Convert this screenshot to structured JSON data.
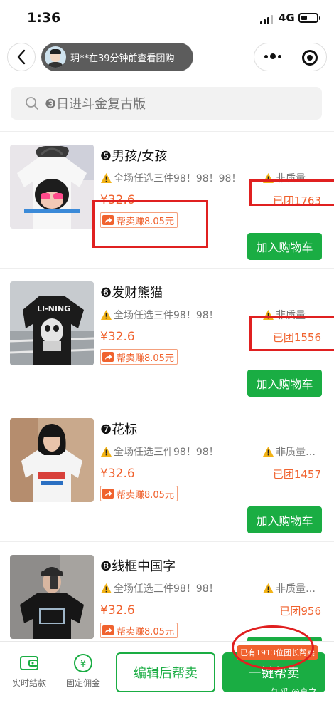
{
  "status_bar": {
    "time": "1:36",
    "network": "4G"
  },
  "nav": {
    "notice_text": "玥**在39分钟前查看团购"
  },
  "search": {
    "text": "❸日进斗金复古版"
  },
  "products": [
    {
      "title": "❺男孩/女孩",
      "promo_left": "全场任选三件98！98！98！",
      "promo_right": "非质量…",
      "price": "¥32.6",
      "sold": "已团1763",
      "earn": "帮卖赚8.05元",
      "cart_label": "加入购物车"
    },
    {
      "title": "❻发财熊猫",
      "promo_left": "全场任选三件98！98！",
      "promo_right": "非质量…",
      "price": "¥32.6",
      "sold": "已团1556",
      "earn": "帮卖赚8.05元",
      "cart_label": "加入购物车"
    },
    {
      "title": "❼花标",
      "promo_left": "全场任选三件98！98！",
      "promo_right": "非质量…",
      "price": "¥32.6",
      "sold": "已团1457",
      "earn": "帮卖赚8.05元",
      "cart_label": "加入购物车"
    },
    {
      "title": "❽线框中国字",
      "promo_left": "全场任选三件98！98！",
      "promo_right": "非质量…",
      "price": "¥32.6",
      "sold": "已团956",
      "earn": "帮卖赚8.05元"
    }
  ],
  "bottom_bar": {
    "realtime_label": "实时结款",
    "fixed_label": "固定佣金",
    "edit_label": "编辑后帮卖",
    "onekey_label": "一键帮卖",
    "leader_badge": "已有1913位团长帮卖"
  },
  "watermark": "知乎 @亮之",
  "colors": {
    "accent_green": "#1aad43",
    "price_orange": "#f0622e",
    "annotation_red": "#e02020"
  },
  "icons": [
    "back-arrow-icon",
    "avatar",
    "more-dots-icon",
    "close-circle-icon",
    "search-icon",
    "warning-icon",
    "share-arrow-icon",
    "wallet-icon",
    "yuan-icon"
  ]
}
